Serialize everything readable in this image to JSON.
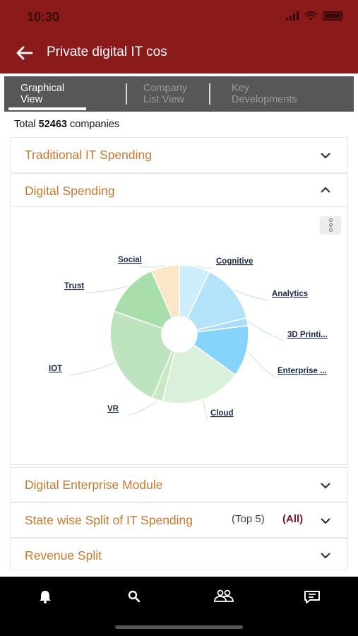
{
  "status_bar": {
    "time": "10:30"
  },
  "header": {
    "title": "Private digital IT cos"
  },
  "tabs": [
    {
      "line1": "Graphical",
      "line2": "View",
      "active": true
    },
    {
      "line1": "Company",
      "line2": "List View",
      "active": false
    },
    {
      "line1": "Key",
      "line2": "Developments",
      "active": false
    }
  ],
  "summary": {
    "prefix": "Total",
    "count": "52463",
    "suffix": "companies"
  },
  "sections": {
    "traditional": "Traditional IT Spending",
    "digital": "Digital Spending",
    "enterprise": "Digital Enterprise Module",
    "state": "State wise Split of IT Spending",
    "state_top": "(Top 5)",
    "state_all": "(All)",
    "revenue": "Revenue Split"
  },
  "chart_data": {
    "type": "pie",
    "donut": true,
    "series": [
      {
        "name": "Cognitive",
        "share": 0.072,
        "color": "#cfeefc"
      },
      {
        "name": "Analytics",
        "share": 0.14,
        "color": "#b4e2fb"
      },
      {
        "name": "3D Printi...",
        "share": 0.018,
        "color": "#a8ddf9"
      },
      {
        "name": "Enterprise ...",
        "share": 0.12,
        "color": "#86d4fb"
      },
      {
        "name": "Cloud",
        "share": 0.19,
        "color": "#d9f1da"
      },
      {
        "name": "VR",
        "share": 0.024,
        "color": "#c6e9c4"
      },
      {
        "name": "IOT",
        "share": 0.24,
        "color": "#bde4bf"
      },
      {
        "name": "Trust",
        "share": 0.13,
        "color": "#a8deab"
      },
      {
        "name": "Social",
        "share": 0.066,
        "color": "#fbe6c8"
      }
    ]
  },
  "colors": {
    "header": "#8b1a1a",
    "accent": "#c8782e",
    "tabbar": "#575757"
  },
  "nav": [
    {
      "icon": "bell-icon"
    },
    {
      "icon": "search-icon"
    },
    {
      "icon": "people-icon"
    },
    {
      "icon": "chat-icon"
    }
  ]
}
